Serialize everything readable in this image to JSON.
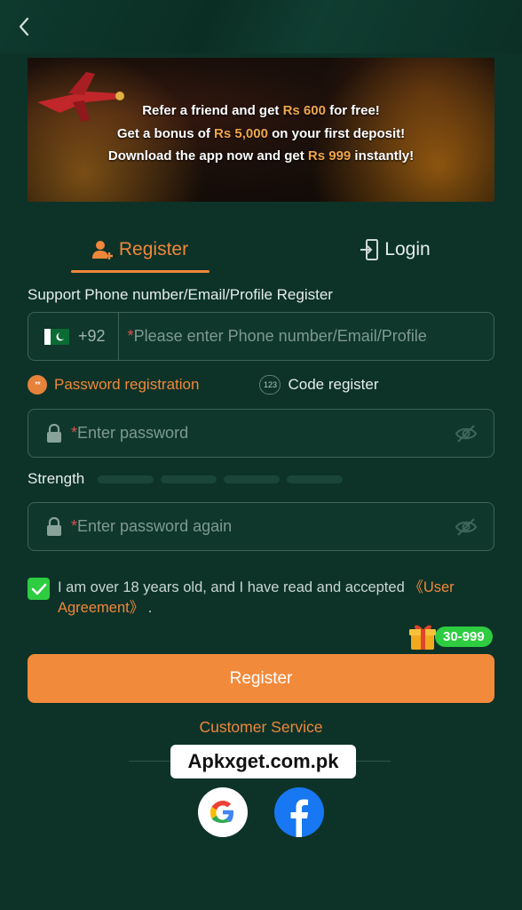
{
  "nav": {
    "back_icon": "chevron-left-icon"
  },
  "banner": {
    "line1": {
      "pre": "Refer a friend and get ",
      "highlight": "Rs 600",
      "post": " for free!"
    },
    "line2": {
      "pre": "Get a bonus of ",
      "highlight": "Rs 5,000",
      "post": " on your first deposit!"
    },
    "line3": {
      "pre": "Download the app now and get ",
      "highlight": "Rs 999",
      "post": " instantly!"
    }
  },
  "tabs": {
    "register": "Register",
    "login": "Login",
    "active": "register"
  },
  "form": {
    "support_label": "Support Phone number/Email/Profile Register",
    "country_code": "+92",
    "phone_placeholder": "Please enter Phone number/Email/Profile",
    "mode_password": "Password registration",
    "mode_password_icon": "**",
    "mode_code": "Code register",
    "mode_code_icon": "123",
    "password_placeholder": "Enter password",
    "strength_label": "Strength",
    "strength_level": 0,
    "password_again_placeholder": "Enter password again",
    "required_mark": "*",
    "agreement_text": "I am over 18 years old, and I have read and accepted ",
    "agreement_link": "《User Agreement》",
    "agreement_end": " .",
    "agreement_checked": true
  },
  "gift_badge": "30-999",
  "register_button": "Register",
  "customer_service": "Customer Service",
  "watermark": "Apkxget.com.pk",
  "colors": {
    "accent": "#f28a3c",
    "background": "#0d3328",
    "check": "#2ecc40"
  }
}
